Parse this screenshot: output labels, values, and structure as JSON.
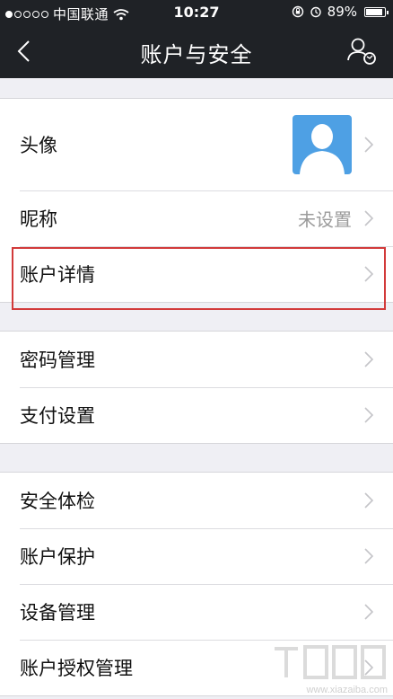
{
  "status_bar": {
    "carrier": "中国联通",
    "time": "10:27",
    "battery_percent": "89%",
    "battery_level": 0.89
  },
  "nav": {
    "title": "账户与安全",
    "back_icon": "chevron-left-icon",
    "action_icon": "user-switch-icon"
  },
  "groups": [
    {
      "rows": [
        {
          "label": "头像",
          "avatar": true
        },
        {
          "label": "昵称",
          "value": "未设置"
        },
        {
          "label": "账户详情",
          "highlighted": true
        }
      ]
    },
    {
      "rows": [
        {
          "label": "密码管理"
        },
        {
          "label": "支付设置"
        }
      ]
    },
    {
      "rows": [
        {
          "label": "安全体检"
        },
        {
          "label": "账户保护"
        },
        {
          "label": "设备管理"
        },
        {
          "label": "账户授权管理"
        }
      ]
    }
  ],
  "watermark": {
    "text": "www.xiazaiba.com"
  },
  "colors": {
    "nav_background": "#1f2226",
    "page_background": "#efeff4",
    "avatar_blue": "#4ea0e4",
    "highlight_red": "#d23a3a",
    "secondary_text": "#9b9b9b"
  }
}
